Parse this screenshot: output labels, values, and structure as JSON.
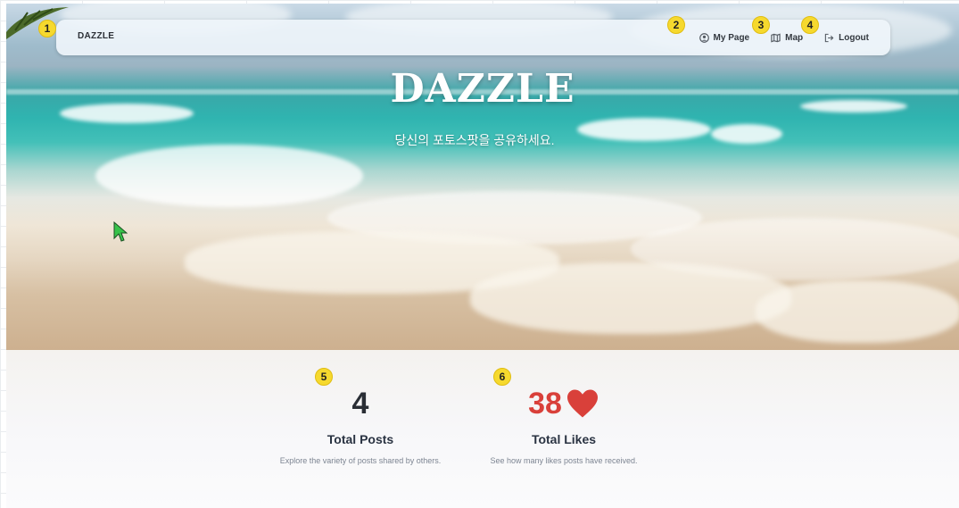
{
  "navbar": {
    "brand": "DAZZLE",
    "links": [
      {
        "label": "My Page",
        "icon": "user-circle-icon"
      },
      {
        "label": "Map",
        "icon": "map-icon"
      },
      {
        "label": "Logout",
        "icon": "logout-icon"
      }
    ]
  },
  "hero": {
    "title": "DAZZLE",
    "subtitle": "당신의 포토스팟을 공유하세요."
  },
  "stats": [
    {
      "value": "4",
      "title": "Total Posts",
      "description": "Explore the variety of posts shared by others.",
      "color": "#2a2e35"
    },
    {
      "value": "38",
      "title": "Total Likes",
      "description": "See how many likes posts have received.",
      "color": "#d9403a",
      "icon": "heart-icon"
    }
  ],
  "markers": [
    "1",
    "2",
    "3",
    "4",
    "5",
    "6"
  ],
  "colors": {
    "marker": "#f6d92e",
    "likes": "#d9403a"
  }
}
